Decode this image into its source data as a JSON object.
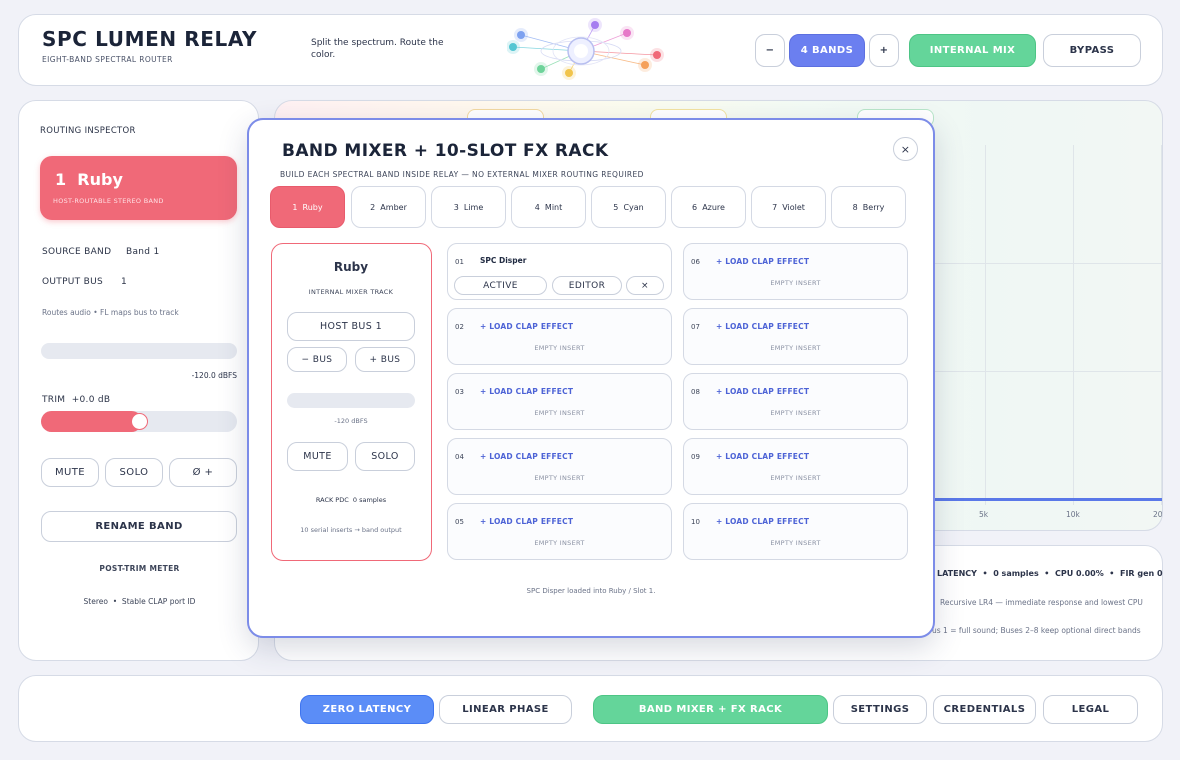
{
  "header": {
    "title": "SPC LUMEN RELAY",
    "subtitle": "EIGHT-BAND SPECTRAL ROUTER",
    "tagline": "Split the spectrum. Route the color.",
    "minus_label": "−",
    "bands_label": "4 BANDS",
    "plus_label": "+",
    "internal_mix_label": "INTERNAL MIX",
    "bypass_label": "BYPASS"
  },
  "inspector": {
    "heading": "ROUTING INSPECTOR",
    "band_title": "1  Ruby",
    "band_caption": "HOST-ROUTABLE STEREO BAND",
    "source_label": "SOURCE BAND",
    "source_value": "Band 1",
    "output_label": "OUTPUT BUS",
    "output_value": "1",
    "route_note": "Routes audio • FL maps bus to track",
    "meter_readout": "-120.0 dBFS",
    "trim_label": "TRIM  +0.0 dB",
    "trim_fraction": 0.5,
    "mute_label": "MUTE",
    "solo_label": "SOLO",
    "phase_label": "Ø +",
    "rename_label": "RENAME BAND",
    "post_trim_label": "POST-TRIM METER",
    "footer_note": "Stereo  •  Stable CLAP port ID"
  },
  "analyzer": {
    "ticks": [
      "5k",
      "10k",
      "20k"
    ],
    "status_line": "LATENCY  •  0 samples  •  CPU 0.00%  •  FIR gen 0",
    "mode_line": "Recursive LR4 — immediate response and lowest CPU",
    "bus_line": "us 1 = full sound; Buses 2–8 keep optional direct bands"
  },
  "modal": {
    "title": "BAND MIXER + 10-SLOT FX RACK",
    "subtitle": "BUILD EACH SPECTRAL BAND INSIDE RELAY — NO EXTERNAL MIXER ROUTING REQUIRED",
    "close_label": "×",
    "tabs": [
      {
        "label": "1  Ruby"
      },
      {
        "label": "2  Amber"
      },
      {
        "label": "3  Lime"
      },
      {
        "label": "4  Mint"
      },
      {
        "label": "5  Cyan"
      },
      {
        "label": "6  Azure"
      },
      {
        "label": "7  Violet"
      },
      {
        "label": "8  Berry"
      }
    ],
    "track": {
      "name": "Ruby",
      "caption": "INTERNAL MIXER TRACK",
      "host_bus_label": "HOST BUS 1",
      "minus_bus_label": "− BUS",
      "plus_bus_label": "+ BUS",
      "meter_readout": "-120 dBFS",
      "mute_label": "MUTE",
      "solo_label": "SOLO",
      "pdc_label": "RACK PDC  0 samples",
      "note": "10 serial inserts → band output"
    },
    "slot1": {
      "num": "01",
      "name": "SPC Disper",
      "active_label": "ACTIVE",
      "editor_label": "EDITOR",
      "remove_label": "×"
    },
    "slots": [
      {
        "num": "02",
        "load": "+ LOAD CLAP EFFECT",
        "empty": "EMPTY INSERT"
      },
      {
        "num": "03",
        "load": "+ LOAD CLAP EFFECT",
        "empty": "EMPTY INSERT"
      },
      {
        "num": "04",
        "load": "+ LOAD CLAP EFFECT",
        "empty": "EMPTY INSERT"
      },
      {
        "num": "05",
        "load": "+ LOAD CLAP EFFECT",
        "empty": "EMPTY INSERT"
      },
      {
        "num": "06",
        "load": "+ LOAD CLAP EFFECT",
        "empty": "EMPTY INSERT"
      },
      {
        "num": "07",
        "load": "+ LOAD CLAP EFFECT",
        "empty": "EMPTY INSERT"
      },
      {
        "num": "08",
        "load": "+ LOAD CLAP EFFECT",
        "empty": "EMPTY INSERT"
      },
      {
        "num": "09",
        "load": "+ LOAD CLAP EFFECT",
        "empty": "EMPTY INSERT"
      },
      {
        "num": "10",
        "load": "+ LOAD CLAP EFFECT",
        "empty": "EMPTY INSERT"
      }
    ],
    "status": "SPC Disper loaded into Ruby / Slot 1."
  },
  "footer": {
    "zero_latency_label": "ZERO LATENCY",
    "linear_phase_label": "LINEAR PHASE",
    "band_mixer_label": "BAND MIXER + FX RACK",
    "settings_label": "SETTINGS",
    "credentials_label": "CREDENTIALS",
    "legal_label": "LEGAL"
  },
  "colors": {
    "ruby": "#f06978",
    "accent_blue": "#6b7ff0",
    "accent_green": "#64d59a",
    "link_blue": "#4d63d6"
  }
}
